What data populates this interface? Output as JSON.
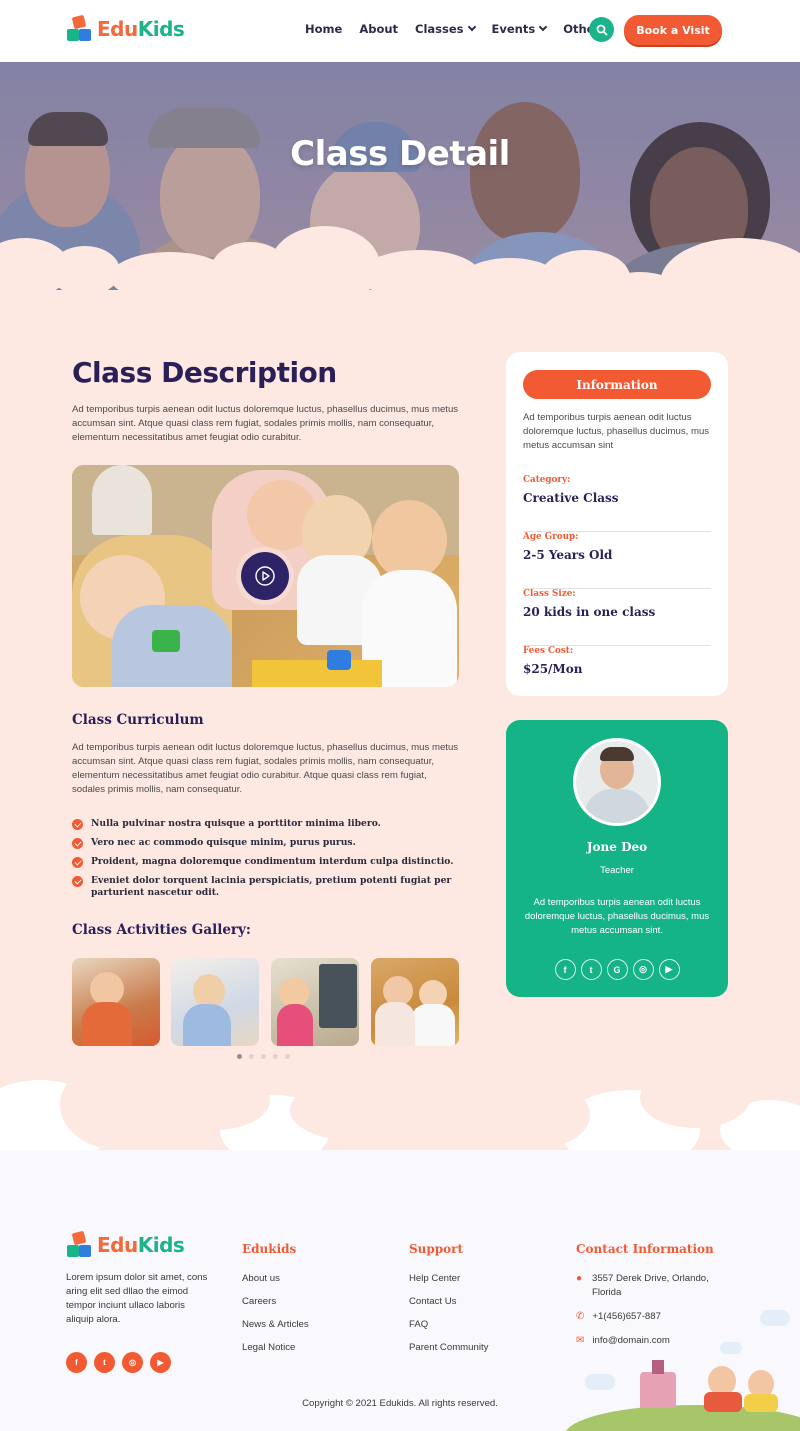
{
  "brand": {
    "part1": "Edu",
    "part2": "Kids"
  },
  "nav": {
    "items": [
      {
        "label": "Home",
        "dropdown": false
      },
      {
        "label": "About",
        "dropdown": false
      },
      {
        "label": "Classes",
        "dropdown": true
      },
      {
        "label": "Events",
        "dropdown": true
      },
      {
        "label": "Other",
        "dropdown": true
      }
    ],
    "cta": "Book a Visit",
    "search_icon": "search-icon"
  },
  "hero": {
    "title": "Class Detail"
  },
  "description": {
    "title": "Class Description",
    "text": "Ad temporibus turpis aenean odit luctus doloremque luctus, phasellus ducimus, mus metus accumsan sint. Atque quasi class rem fugiat, sodales primis mollis, nam consequatur, elementum necessitatibus amet feugiat odio curabitur."
  },
  "curriculum": {
    "title": "Class Curriculum",
    "text": "Ad temporibus turpis aenean odit luctus doloremque luctus, phasellus ducimus, mus metus accumsan sint. Atque quasi class rem fugiat, sodales primis mollis, nam consequatur, elementum necessitatibus amet feugiat odio curabitur. Atque quasi class rem fugiat, sodales primis mollis, nam consequatur.",
    "points": [
      "Nulla pulvinar nostra quisque a porttitor minima libero.",
      "Vero nec ac commodo quisque minim, purus purus.",
      "Proident, magna doloremque condimentum interdum culpa distinctio.",
      "Eveniet dolor torquent lacinia perspiciatis, pretium potenti fugiat per parturient nascetur odit."
    ]
  },
  "gallery": {
    "title": "Class Activities Gallery:",
    "active_dot": 1,
    "dot_count": 5
  },
  "info": {
    "button": "Information",
    "text": "Ad temporibus turpis aenean odit luctus doloremque luctus, phasellus ducimus, mus metus accumsan sint",
    "rows": [
      {
        "label": "Category:",
        "value": "Creative Class"
      },
      {
        "label": "Age Group:",
        "value": "2-5 Years Old"
      },
      {
        "label": "Class Size:",
        "value": "20 kids in one class"
      },
      {
        "label": "Fees Cost:",
        "value": "$25/Mon"
      }
    ]
  },
  "teacher": {
    "name": "Jone Deo",
    "role": "Teacher",
    "text": "Ad temporibus turpis aenean odit luctus doloremque luctus, phasellus ducimus, mus metus accumsan sint.",
    "socials": [
      "facebook-icon",
      "twitter-icon",
      "google-icon",
      "instagram-icon",
      "youtube-icon"
    ]
  },
  "footer": {
    "about": "Lorem ipsum dolor sit amet, cons aring elit sed dllao the eimod tempor inciunt ullaco laboris aliquip alora.",
    "socials": [
      "facebook-icon",
      "twitter-icon",
      "instagram-icon",
      "youtube-icon"
    ],
    "col1": {
      "title": "Edukids",
      "links": [
        "About us",
        "Careers",
        "News & Articles",
        "Legal Notice"
      ]
    },
    "col2": {
      "title": "Support",
      "links": [
        "Help Center",
        "Contact Us",
        "FAQ",
        "Parent Community"
      ]
    },
    "contact": {
      "title": "Contact Information",
      "address": "3557 Derek Drive, Orlando, Florida",
      "phone": "+1(456)657-887",
      "email": "info@domain.com"
    },
    "copyright": "Copyright © 2021 Edukids. All rights reserved."
  },
  "colors": {
    "accent": "#f15a33",
    "green": "#14b487",
    "navy": "#2a1f57",
    "peach": "#fde8e2"
  }
}
